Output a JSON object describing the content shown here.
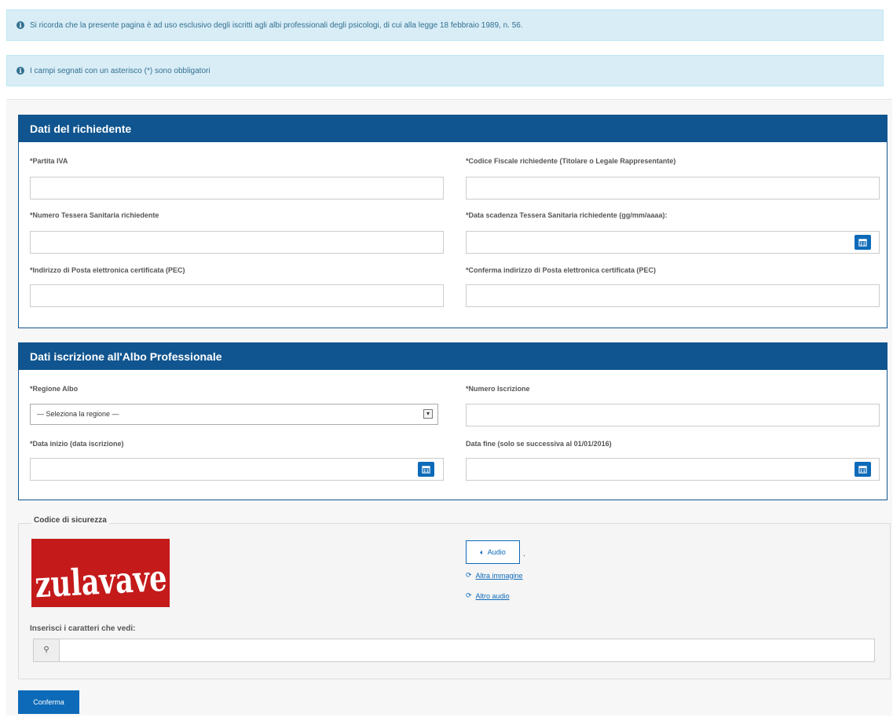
{
  "notices": {
    "privacy": "Si ricorda che la presente pagina è ad uso esclusivo degli iscritti agli albi professionali degli psicologi, di cui alla legge 18 febbraio 1989, n. 56.",
    "required": "I campi segnati con un asterisco (*) sono obbligatori"
  },
  "section_richiedente": {
    "title": "Dati del richiedente",
    "partita_iva_label": "*Partita IVA",
    "codice_fiscale_label": "*Codice Fiscale richiedente (Titolare o Legale Rappresentante)",
    "tessera_label": "*Numero Tessera Sanitaria richiedente",
    "scadenza_label": "*Data scadenza Tessera Sanitaria richiedente (gg/mm/aaaa):",
    "pec_label": "*Indirizzo di Posta elettronica certificata (PEC)",
    "pec_confirm_label": "*Conferma indirizzo di Posta elettronica certificata (PEC)"
  },
  "section_albo": {
    "title": "Dati iscrizione all'Albo Professionale",
    "regione_label": "*Regione Albo",
    "regione_selected": "— Seleziona la regione —",
    "numero_label": "*Numero Iscrizione",
    "data_inizio_label": "*Data inizio (data iscrizione)",
    "data_fine_label": "Data fine (solo se successiva al 01/01/2016)"
  },
  "captcha": {
    "legend": "Codice di sicurezza",
    "image_text": "zulavave",
    "audio_label": "Audio",
    "altra_immagine": "Altra immagine",
    "altro_audio": "Altro audio",
    "input_label": "Inserisci i caratteri che vedi:"
  },
  "submit_label": "Conferma",
  "colors": {
    "primary": "#10558f",
    "button": "#0d6ab8",
    "info_bg": "#d9edf7",
    "captcha_red": "#c41a1a"
  }
}
